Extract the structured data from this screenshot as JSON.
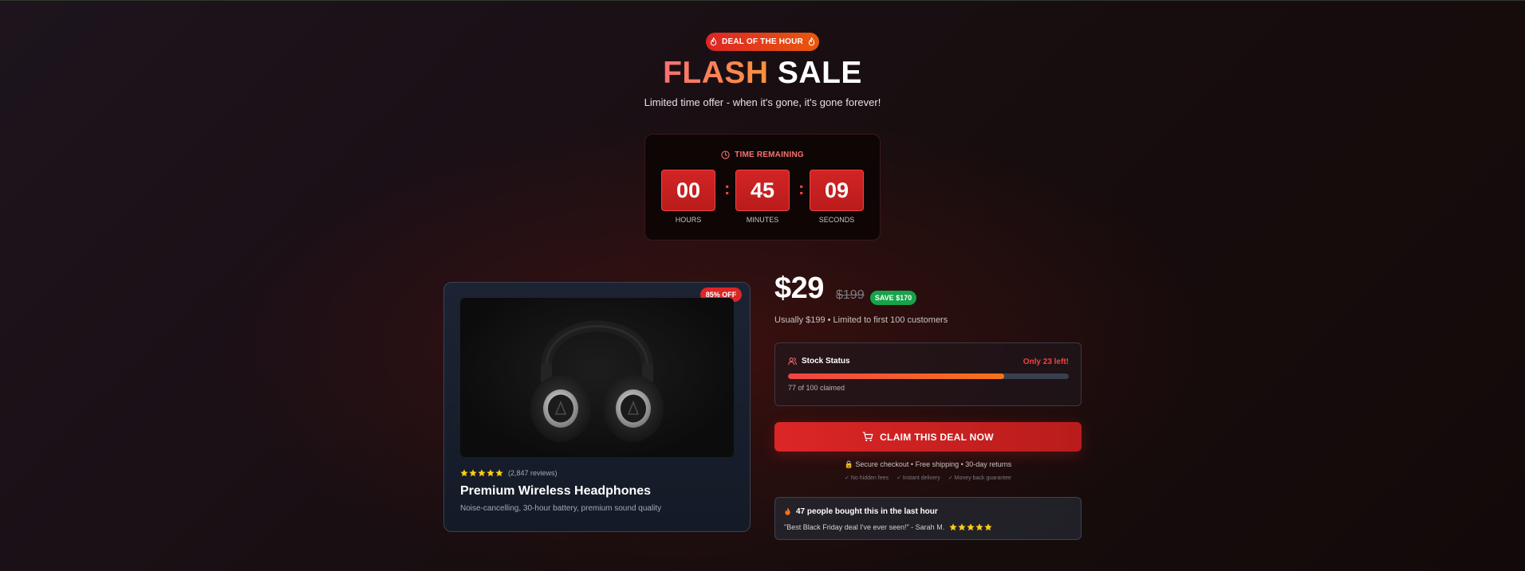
{
  "badge": {
    "label": "DEAL OF THE HOUR",
    "icon": "flame-icon"
  },
  "title": {
    "word1": "FLASH",
    "word2": "SALE"
  },
  "subtitle": "Limited time offer - when it's gone, it's gone forever!",
  "countdown": {
    "label": "TIME REMAINING",
    "icon": "clock-icon",
    "hours": "00",
    "minutes": "45",
    "seconds": "09",
    "hours_label": "HOURS",
    "minutes_label": "MINUTES",
    "seconds_label": "SECONDS",
    "separator": ":"
  },
  "product": {
    "discount_badge": "85% OFF",
    "image": "headphones-image",
    "rating_stars": 5,
    "reviews": "(2,847 reviews)",
    "name": "Premium Wireless Headphones",
    "description": "Noise-cancelling, 30-hour battery, premium sound quality"
  },
  "pricing": {
    "price": "$29",
    "old_price": "$199",
    "save_badge": "SAVE $170",
    "note": "Usually $199 • Limited to first 100 customers"
  },
  "stock": {
    "title": "Stock Status",
    "icon": "users-icon",
    "remaining": "Only 23 left!",
    "claimed_text": "77 of 100 claimed",
    "claimed_fraction": 0.77
  },
  "cta": {
    "label": "CLAIM THIS DEAL NOW",
    "icon": "cart-icon"
  },
  "secure": {
    "text": "🔒 Secure checkout • Free shipping • 30-day returns",
    "items": [
      "✓ No hidden fees",
      "✓ Instant delivery",
      "✓ Money back guarantee"
    ]
  },
  "social_proof": {
    "headline": "47 people bought this in the last hour",
    "icon": "flame-icon",
    "quote": "\"Best Black Friday deal I've ever seen!\" - Sarah M.",
    "stars": 5
  },
  "colors": {
    "accent_red": "#dc2626",
    "accent_orange": "#f97316",
    "success_green": "#16a34a",
    "star_gold": "#facc15"
  }
}
